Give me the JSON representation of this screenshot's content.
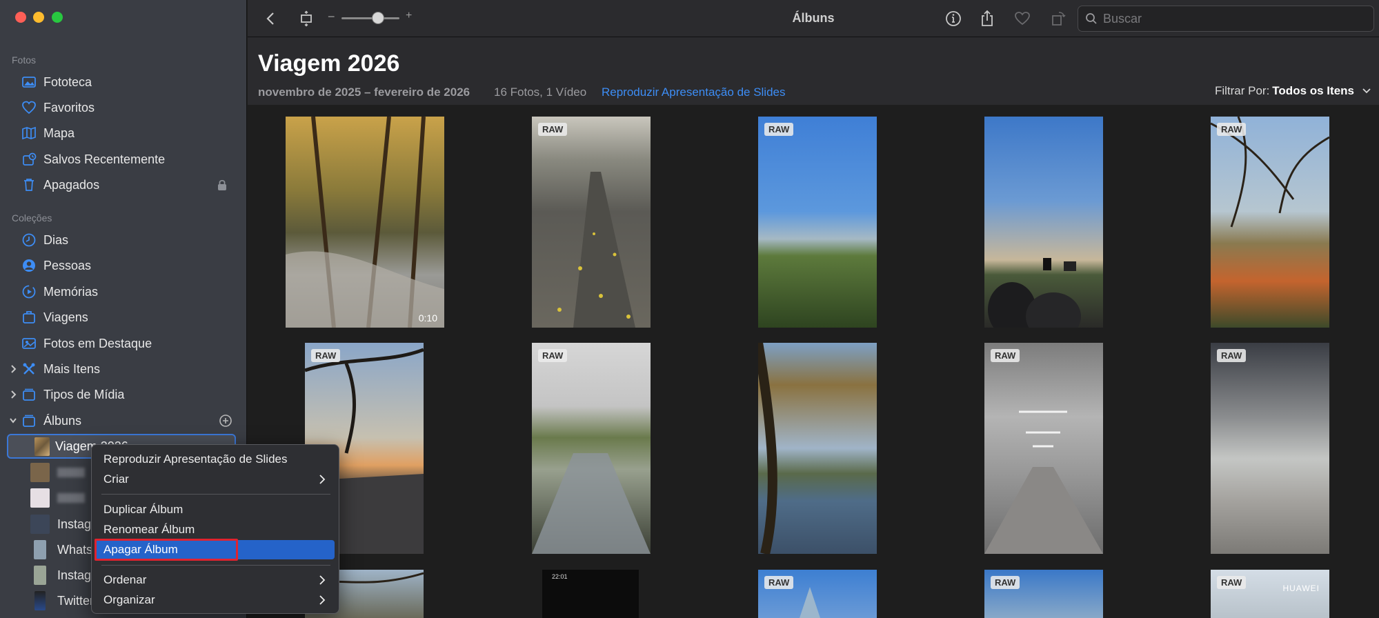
{
  "window": {
    "title": "Álbuns"
  },
  "search": {
    "placeholder": "Buscar"
  },
  "sidebar": {
    "sections": {
      "fotos": "Fotos",
      "colecoes": "Coleções"
    },
    "fotos_items": [
      {
        "label": "Fototeca",
        "icon": "photo-library-icon"
      },
      {
        "label": "Favoritos",
        "icon": "heart-icon"
      },
      {
        "label": "Mapa",
        "icon": "map-icon"
      },
      {
        "label": "Salvos Recentemente",
        "icon": "recently-saved-icon"
      },
      {
        "label": "Apagados",
        "icon": "trash-icon"
      }
    ],
    "colecoes_items": [
      {
        "label": "Dias",
        "icon": "clock-icon"
      },
      {
        "label": "Pessoas",
        "icon": "person-icon"
      },
      {
        "label": "Memórias",
        "icon": "memories-icon"
      },
      {
        "label": "Viagens",
        "icon": "suitcase-icon"
      },
      {
        "label": "Fotos em Destaque",
        "icon": "featured-photos-icon"
      },
      {
        "label": "Mais Itens",
        "icon": "tools-icon"
      },
      {
        "label": "Tipos de Mídia",
        "icon": "media-types-icon"
      },
      {
        "label": "Álbuns",
        "icon": "albums-icon"
      }
    ],
    "albums": [
      {
        "label": "Viagem 2026",
        "selected": true
      },
      {
        "label": ""
      },
      {
        "label": ""
      },
      {
        "label": "Instagr"
      },
      {
        "label": "Whats"
      },
      {
        "label": "Instagr"
      },
      {
        "label": "Twitter"
      }
    ]
  },
  "album": {
    "title": "Viagem 2026",
    "date_range": "novembro de 2025 – fevereiro de 2026",
    "item_count": "16 Fotos, 1 Vídeo",
    "slideshow_link": "Reproduzir Apresentação de Slides",
    "filter_label": "Filtrar Por:",
    "filter_value": "Todos os Itens"
  },
  "photos": [
    {
      "badge": "",
      "duration": "0:10"
    },
    {
      "badge": "RAW",
      "duration": ""
    },
    {
      "badge": "RAW",
      "duration": ""
    },
    {
      "badge": "",
      "duration": ""
    },
    {
      "badge": "RAW",
      "duration": ""
    },
    {
      "badge": "RAW",
      "duration": ""
    },
    {
      "badge": "RAW",
      "duration": ""
    },
    {
      "badge": "",
      "duration": ""
    },
    {
      "badge": "RAW",
      "duration": ""
    },
    {
      "badge": "RAW",
      "duration": ""
    },
    {
      "badge": "",
      "duration": ""
    },
    {
      "badge": "",
      "duration": "",
      "status_time": "22:01"
    },
    {
      "badge": "RAW",
      "duration": ""
    },
    {
      "badge": "RAW",
      "duration": ""
    },
    {
      "badge": "RAW",
      "duration": "",
      "caption": "HUAWEI"
    }
  ],
  "context_menu": {
    "items": [
      "Reproduzir Apresentação de Slides",
      "Criar",
      "Duplicar Álbum",
      "Renomear Álbum",
      "Apagar Álbum",
      "Ordenar",
      "Organizar"
    ],
    "highlighted": "Apagar Álbum"
  },
  "colors": {
    "accent": "#2563c9",
    "link": "#3d8df5",
    "highlight_outline": "#e0232f"
  }
}
